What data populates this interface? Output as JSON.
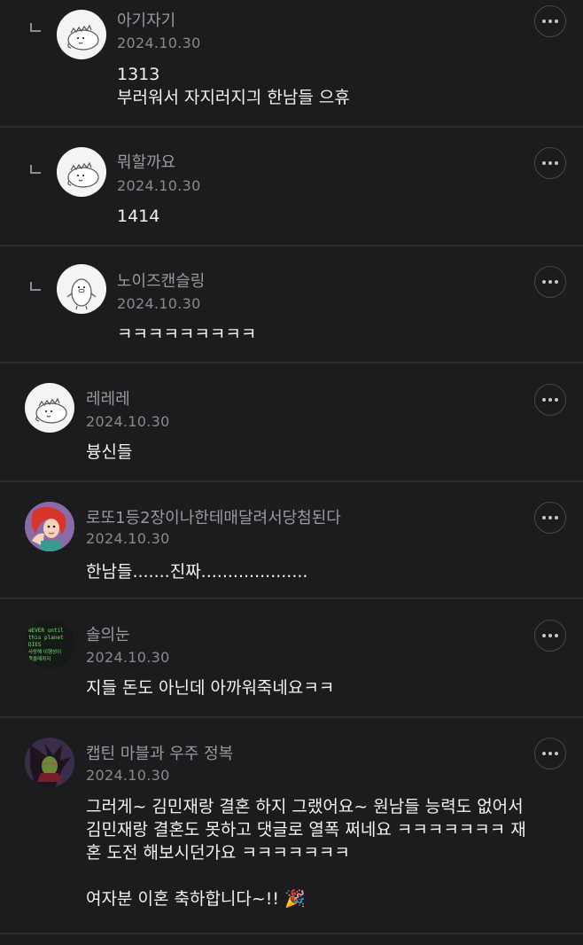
{
  "comments": [
    {
      "nickname": "아기자기",
      "date": "2024.10.30",
      "text": "1313\n부러워서 자지러지긔 한남들 으휴",
      "reply": true,
      "avatar": "creature-avatar-icon"
    },
    {
      "nickname": "뭐할까요",
      "date": "2024.10.30",
      "text": "1414",
      "reply": true,
      "avatar": "creature-avatar-icon"
    },
    {
      "nickname": "노이즈캔슬링",
      "date": "2024.10.30",
      "text": "ㅋㅋㅋㅋㅋㅋㅋㅋㅋ",
      "reply": true,
      "avatar": "penguin-avatar-icon"
    },
    {
      "nickname": "레레레",
      "date": "2024.10.30",
      "text": "븅신들",
      "reply": false,
      "avatar": "creature-avatar-icon"
    },
    {
      "nickname": "로또1등2장이나한테매달려서당첨된다",
      "date": "2024.10.30",
      "text": "한남들.......진짜....................",
      "reply": false,
      "avatar": "mermaid-avatar-icon"
    },
    {
      "nickname": "솔의눈",
      "date": "2024.10.30",
      "text": "지들 돈도 아닌데 아까워죽네요ㅋㅋ",
      "reply": false,
      "avatar": "text-avatar-icon"
    },
    {
      "nickname": "캡틴 마블과 우주 정복",
      "date": "2024.10.30",
      "text": "그러게~ 김민재랑 결혼 하지 그랬어요~ 원남들 능력도 없어서\n김민재랑 결혼도 못하고 댓글로 열폭 쩌네요 ㅋㅋㅋㅋㅋㅋㅋ 재\n혼 도전 해보시던가요 ㅋㅋㅋㅋㅋㅋㅋ\n\n여자분 이혼 축하합니다~!! 🎉",
      "reply": false,
      "avatar": "warrior-avatar-icon"
    }
  ],
  "avatar_text": {
    "line1": "NEVER until",
    "line2": "this planet",
    "line3": "DIES",
    "line4": "사랑해 이행성이",
    "line5": "죽을때까지"
  },
  "colors": {
    "background": "#1c1c1e",
    "divider": "#2e2e30",
    "nickname": "#9a9a9e",
    "body": "#f2f2f2"
  }
}
